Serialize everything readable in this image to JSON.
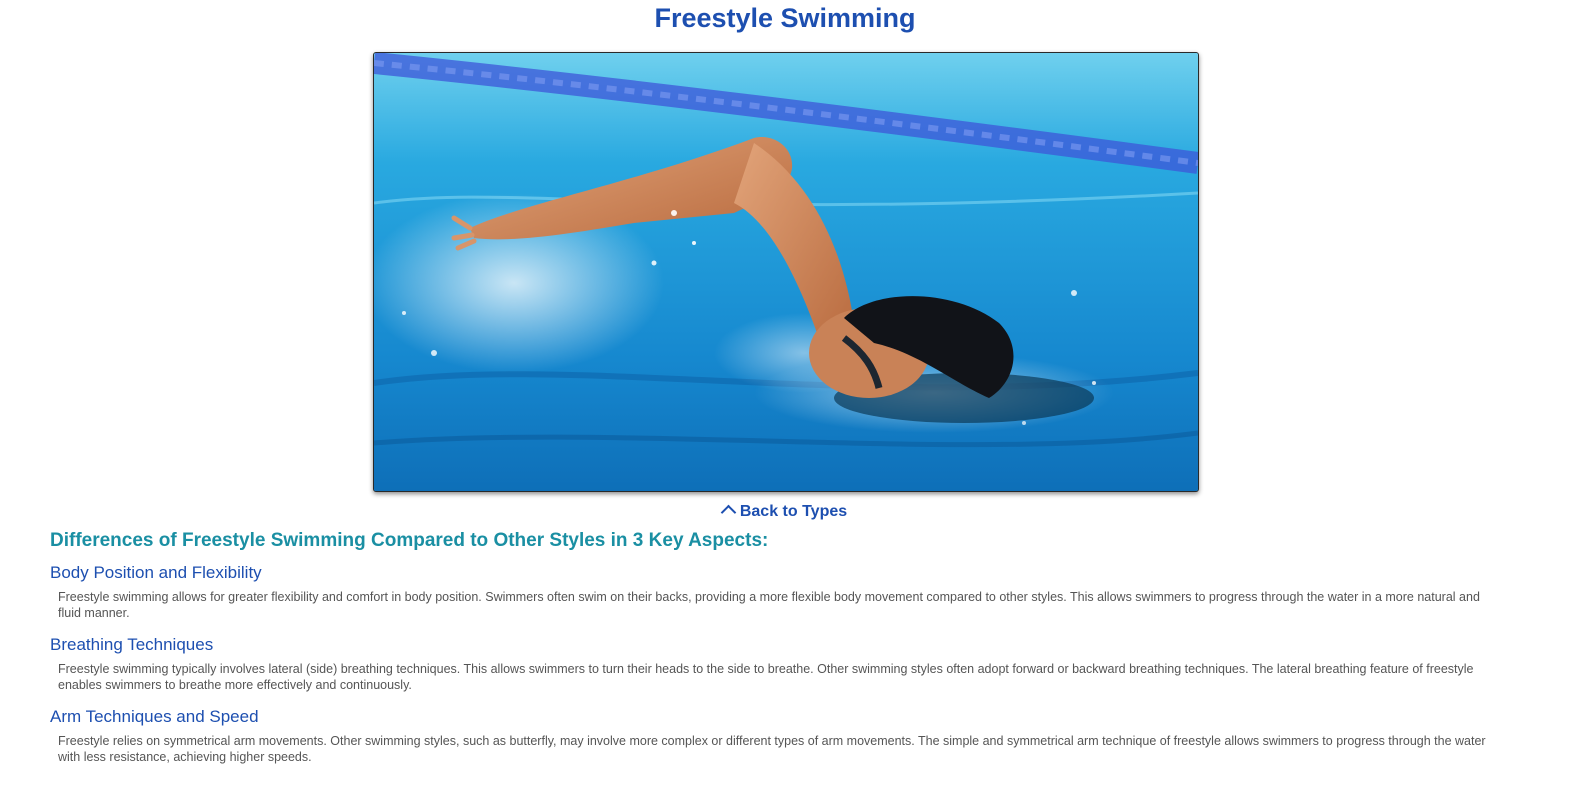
{
  "page": {
    "title": "Freestyle Swimming"
  },
  "hero_image": {
    "alt": "Swimmer doing freestyle stroke in a pool"
  },
  "nav": {
    "back_label": "Back to Types",
    "back_icon": "chevron-up-icon"
  },
  "article": {
    "heading": "Differences of Freestyle Swimming Compared to Other Styles in 3 Key Aspects:",
    "aspects": [
      {
        "title": "Body Position and Flexibility",
        "text": "Freestyle swimming allows for greater flexibility and comfort in body position. Swimmers often swim on their backs, providing a more flexible body movement compared to other styles. This allows swimmers to progress through the water in a more natural and fluid manner."
      },
      {
        "title": "Breathing Techniques",
        "text": "Freestyle swimming typically involves lateral (side) breathing techniques. This allows swimmers to turn their heads to the side to breathe. Other swimming styles often adopt forward or backward breathing techniques. The lateral breathing feature of freestyle enables swimmers to breathe more effectively and continuously."
      },
      {
        "title": "Arm Techniques and Speed",
        "text": "Freestyle relies on symmetrical arm movements. Other swimming styles, such as butterfly, may involve more complex or different types of arm movements. The simple and symmetrical arm technique of freestyle allows swimmers to progress through the water with less resistance, achieving higher speeds."
      }
    ]
  },
  "colors": {
    "title": "#1d4fb0",
    "heading": "#1a8fa3",
    "body_text": "#555555"
  }
}
